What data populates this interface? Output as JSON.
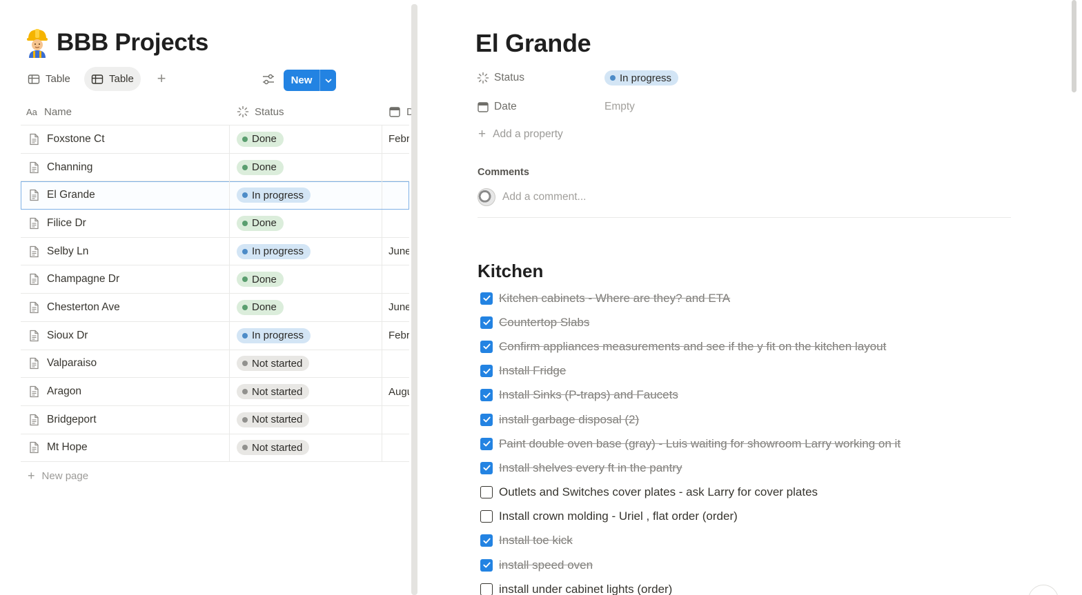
{
  "database": {
    "title": "BBB Projects",
    "icon": "construction-worker-emoji",
    "views": [
      {
        "label": "Table",
        "active": false
      },
      {
        "label": "Table",
        "active": true
      }
    ],
    "new_button_label": "New",
    "columns": {
      "name": "Name",
      "status": "Status",
      "date": "D"
    },
    "rows": [
      {
        "name": "Foxstone Ct",
        "status": "Done",
        "date": "Febr"
      },
      {
        "name": "Channing",
        "status": "Done",
        "date": ""
      },
      {
        "name": "El Grande",
        "status": "In progress",
        "date": ""
      },
      {
        "name": "Filice Dr",
        "status": "Done",
        "date": ""
      },
      {
        "name": "Selby Ln",
        "status": "In progress",
        "date": "June"
      },
      {
        "name": "Champagne Dr",
        "status": "Done",
        "date": ""
      },
      {
        "name": "Chesterton Ave",
        "status": "Done",
        "date": "June"
      },
      {
        "name": "Sioux Dr",
        "status": "In progress",
        "date": "Febr"
      },
      {
        "name": "Valparaiso",
        "status": "Not started",
        "date": ""
      },
      {
        "name": "Aragon",
        "status": "Not started",
        "date": "Augu"
      },
      {
        "name": "Bridgeport",
        "status": "Not started",
        "date": ""
      },
      {
        "name": "Mt Hope",
        "status": "Not started",
        "date": ""
      }
    ],
    "selected_row": "El Grande",
    "new_page_label": "New page"
  },
  "page": {
    "title": "El Grande",
    "properties": {
      "status_label": "Status",
      "status_value": "In progress",
      "date_label": "Date",
      "date_value": "Empty",
      "add_property_label": "Add a property"
    },
    "comments": {
      "heading": "Comments",
      "placeholder": "Add a comment..."
    },
    "section_heading": "Kitchen",
    "todos": [
      {
        "text": "Kitchen cabinets - Where are they? and ETA",
        "checked": true
      },
      {
        "text": "Countertop Slabs",
        "checked": true
      },
      {
        "text": "Confirm appliances measurements and see if the y fit on the kitchen layout",
        "checked": true
      },
      {
        "text": "Install Fridge",
        "checked": true
      },
      {
        "text": "Install Sinks (P-traps) and Faucets",
        "checked": true
      },
      {
        "text": "install garbage disposal (2)",
        "checked": true
      },
      {
        "text": "Paint double oven base (gray) - Luis waiting for showroom Larry working on it",
        "checked": true
      },
      {
        "text": "Install shelves every ft in the pantry",
        "checked": true
      },
      {
        "text": "Outlets and Switches cover plates - ask Larry for cover plates",
        "checked": false
      },
      {
        "text": "Install crown molding - Uriel , flat order (order)",
        "checked": false
      },
      {
        "text": "Install toe kick",
        "checked": true
      },
      {
        "text": "install speed oven",
        "checked": true
      },
      {
        "text": "install under cabinet lights (order)",
        "checked": false
      }
    ]
  },
  "colors": {
    "accent": "#2383e2",
    "done_bg": "#dbeddb",
    "in_progress_bg": "#d3e5f5",
    "not_started_bg": "#e8e7e4"
  }
}
